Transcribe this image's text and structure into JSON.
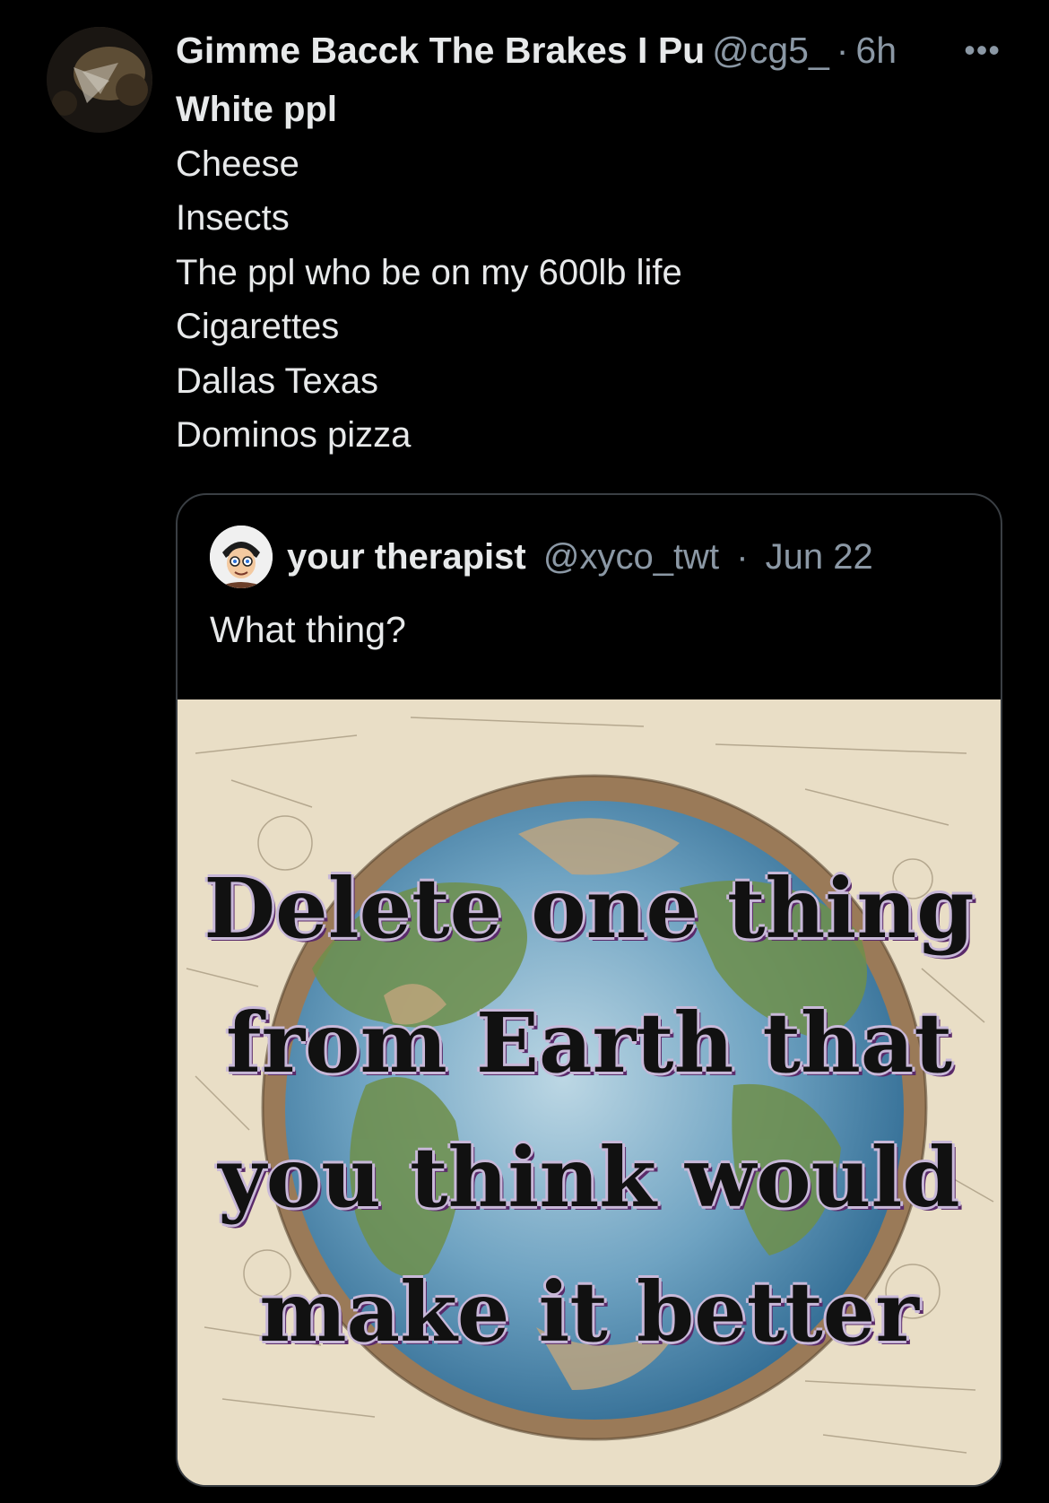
{
  "tweet": {
    "display_name": "Gimme Bacck The Brakes I Pu",
    "handle": "@cg5_",
    "separator": "·",
    "time": "6h",
    "more_label": "•••",
    "lines": [
      "White ppl",
      "Cheese",
      "Insects",
      "The ppl who be on my 600lb life",
      "Cigarettes",
      "Dallas Texas",
      "Dominos pizza"
    ]
  },
  "quoted": {
    "display_name": "your therapist",
    "handle": "@xyco_twt",
    "separator": "·",
    "date": "Jun 22",
    "text": "What thing?",
    "image_text_lines": [
      "Delete one thing",
      "from Earth that",
      "you think would",
      "make it better"
    ]
  },
  "colors": {
    "background": "#000000",
    "primary_text": "#e7e9ea",
    "secondary_text": "#8b98a5",
    "border": "#3a3f44"
  }
}
